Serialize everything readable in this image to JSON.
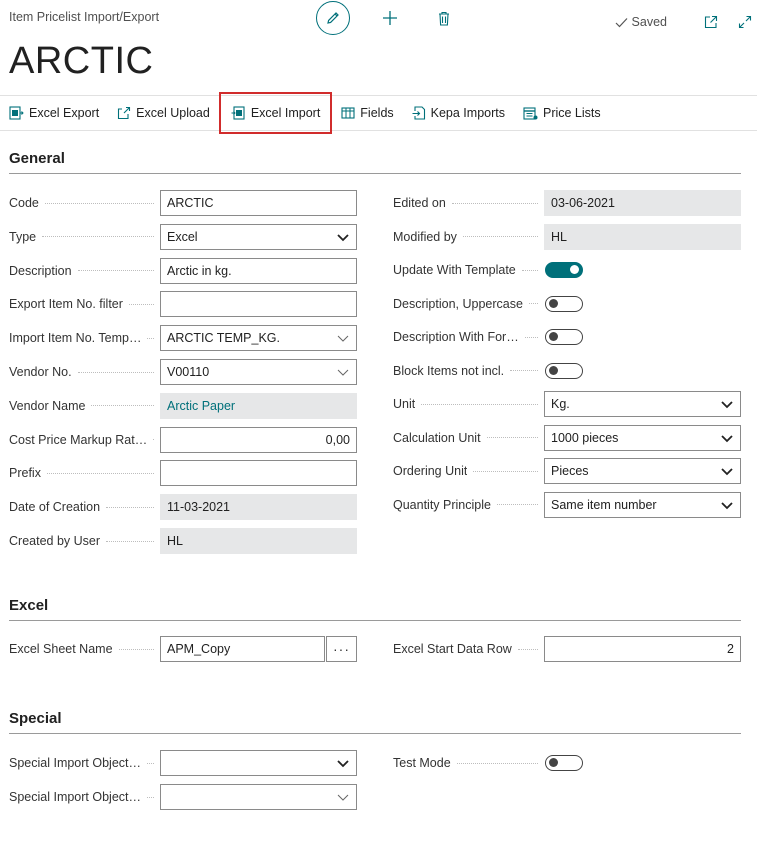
{
  "header": {
    "breadcrumb": "Item Pricelist Import/Export",
    "saved_label": "Saved",
    "title": "ARCTIC",
    "icons": [
      "pencil-icon",
      "plus-icon",
      "trash-icon",
      "checkmark-icon",
      "open-new-window-icon",
      "expand-icon"
    ]
  },
  "actions": [
    {
      "label": "Excel Export",
      "icon": "excel-export-icon"
    },
    {
      "label": "Excel Upload",
      "icon": "upload-icon"
    },
    {
      "label": "Excel Import",
      "icon": "excel-import-icon"
    },
    {
      "label": "Fields",
      "icon": "table-icon"
    },
    {
      "label": "Kepa Imports",
      "icon": "import-icon"
    },
    {
      "label": "Price Lists",
      "icon": "price-list-icon"
    }
  ],
  "general": {
    "title": "General",
    "left": [
      {
        "label": "Code",
        "value": "ARCTIC",
        "kind": "text"
      },
      {
        "label": "Type",
        "value": "Excel",
        "kind": "select"
      },
      {
        "label": "Description",
        "value": "Arctic in kg.",
        "kind": "text"
      },
      {
        "label": "Export Item No. filter",
        "value": "",
        "kind": "text"
      },
      {
        "label": "Import Item No. Temp…",
        "value": "ARCTIC TEMP_KG.",
        "kind": "lookup"
      },
      {
        "label": "Vendor No.",
        "value": "V00110",
        "kind": "lookup"
      },
      {
        "label": "Vendor Name",
        "value": "Arctic Paper",
        "kind": "readonly-link"
      },
      {
        "label": "Cost Price Markup Rat…",
        "value": "0,00",
        "kind": "number"
      },
      {
        "label": "Prefix",
        "value": "",
        "kind": "text"
      },
      {
        "label": "Date of Creation",
        "value": "11-03-2021",
        "kind": "readonly"
      },
      {
        "label": "Created by User",
        "value": "HL",
        "kind": "readonly"
      }
    ],
    "right": [
      {
        "label": "Edited on",
        "value": "03-06-2021",
        "kind": "readonly"
      },
      {
        "label": "Modified by",
        "value": "HL",
        "kind": "readonly"
      },
      {
        "label": "Update With Template",
        "value": true,
        "kind": "toggle"
      },
      {
        "label": "Description, Uppercase",
        "value": false,
        "kind": "toggle"
      },
      {
        "label": "Description With For…",
        "value": false,
        "kind": "toggle"
      },
      {
        "label": "Block Items not incl.",
        "value": false,
        "kind": "toggle"
      },
      {
        "label": "Unit",
        "value": "Kg.",
        "kind": "select"
      },
      {
        "label": "Calculation Unit",
        "value": "1000 pieces",
        "kind": "select"
      },
      {
        "label": "Ordering Unit",
        "value": "Pieces",
        "kind": "select"
      },
      {
        "label": "Quantity  Principle",
        "value": "Same item number",
        "kind": "select"
      }
    ]
  },
  "excel": {
    "title": "Excel",
    "sheet_label": "Excel Sheet Name",
    "sheet_value": "APM_Copy",
    "ellipsis": "···",
    "start_row_label": "Excel Start Data Row",
    "start_row_value": "2"
  },
  "special": {
    "title": "Special",
    "obj1_label": "Special Import Object…",
    "obj1_value": "",
    "obj2_label": "Special Import Object…",
    "obj2_value": "",
    "test_mode_label": "Test Mode",
    "test_mode_value": false
  },
  "colors": {
    "accent": "#00707a",
    "highlight_border": "#d12c2c"
  }
}
